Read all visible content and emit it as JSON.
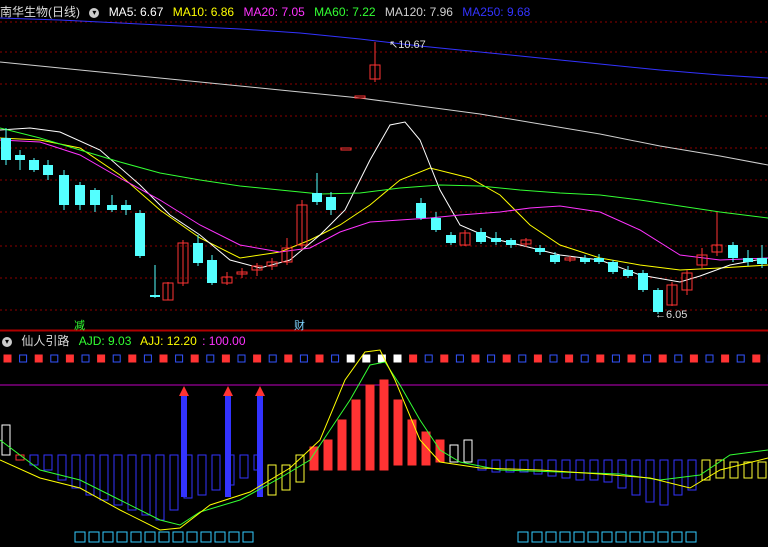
{
  "top_panel": {
    "title": "南华生物(日线)",
    "indicators": [
      {
        "label": "MA5: 6.67",
        "color": "#ffffff"
      },
      {
        "label": "MA10: 6.86",
        "color": "#ffff00"
      },
      {
        "label": "MA20: 7.05",
        "color": "#ff33ff"
      },
      {
        "label": "MA60: 7.22",
        "color": "#33ff33"
      },
      {
        "label": "MA120: 7.96",
        "color": "#d0d0d0"
      },
      {
        "label": "MA250: 9.68",
        "color": "#3333ff"
      }
    ],
    "high_label": "10.67",
    "low_label": "6.05",
    "tag_jian": "减",
    "tag_cai": "财"
  },
  "bottom_panel": {
    "title": "仙人引路",
    "ajd_label": "AJD: 9.03",
    "ajj_label": "AJJ: 12.20",
    "extra_label": ": 100.00"
  },
  "colors": {
    "up": "#ff3333",
    "down": "#54ffff",
    "ma5": "#ffffff",
    "ma10": "#ffff00",
    "ma20": "#ff33ff",
    "ma60": "#33ff33",
    "ma120": "#d0d0d0",
    "ma250": "#3333ff",
    "grid": "#8b0000"
  }
}
